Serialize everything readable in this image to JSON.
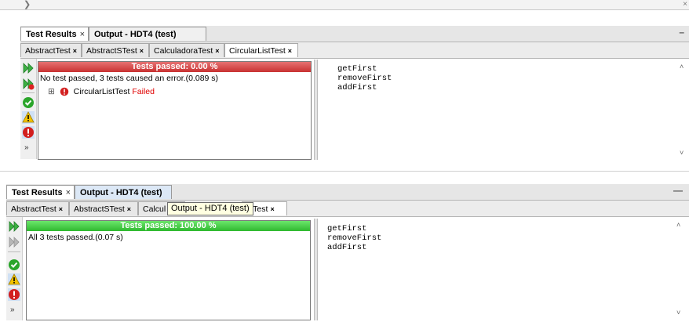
{
  "panel1": {
    "tabs": [
      {
        "label": "Test Results",
        "close": "×"
      },
      {
        "label": "Output - HDT4 (test)",
        "close": ""
      }
    ],
    "minimize": "–",
    "subtabs": [
      {
        "label": "AbstractTest",
        "close": "×"
      },
      {
        "label": "AbstractSTest",
        "close": "×"
      },
      {
        "label": "CalculadoraTest",
        "close": "×"
      },
      {
        "label": "CircularListTest",
        "close": "×"
      }
    ],
    "progress_text": "Tests passed: 0.00 %",
    "summary": "No test passed, 3 tests caused an error.(0.089 s)",
    "tree": {
      "expander": "⊞",
      "name": "CircularListTest",
      "status": "Failed"
    },
    "output_lines": [
      "getFirst",
      "removeFirst",
      "addFirst"
    ],
    "more": "»"
  },
  "panel2": {
    "tabs": [
      {
        "label": "Test Results",
        "close": "×"
      },
      {
        "label": "Output - HDT4 (test)",
        "close": ""
      }
    ],
    "minimize": "—",
    "subtabs": [
      {
        "label": "AbstractTest",
        "close": "×"
      },
      {
        "label": "AbstractSTest",
        "close": "×"
      },
      {
        "label": "Calcul",
        "close": ""
      },
      {
        "label": "stTest",
        "close": "×"
      }
    ],
    "tooltip": "Output - HDT4 (test)",
    "progress_text": "Tests passed: 100.00 %",
    "summary": "All 3 tests passed.(0.07 s)",
    "output_lines": [
      "getFirst",
      "removeFirst",
      "addFirst"
    ],
    "more": "»"
  },
  "colors": {
    "fail_bar": "#c83232",
    "pass_bar": "#2fb82f",
    "failed_text": "#e00000",
    "tooltip_bg": "#ffffe1"
  },
  "icons": [
    "rerun-icon",
    "rerun-failed-icon",
    "passed-filter-icon",
    "warning-filter-icon",
    "error-filter-icon",
    "error-badge-icon"
  ]
}
